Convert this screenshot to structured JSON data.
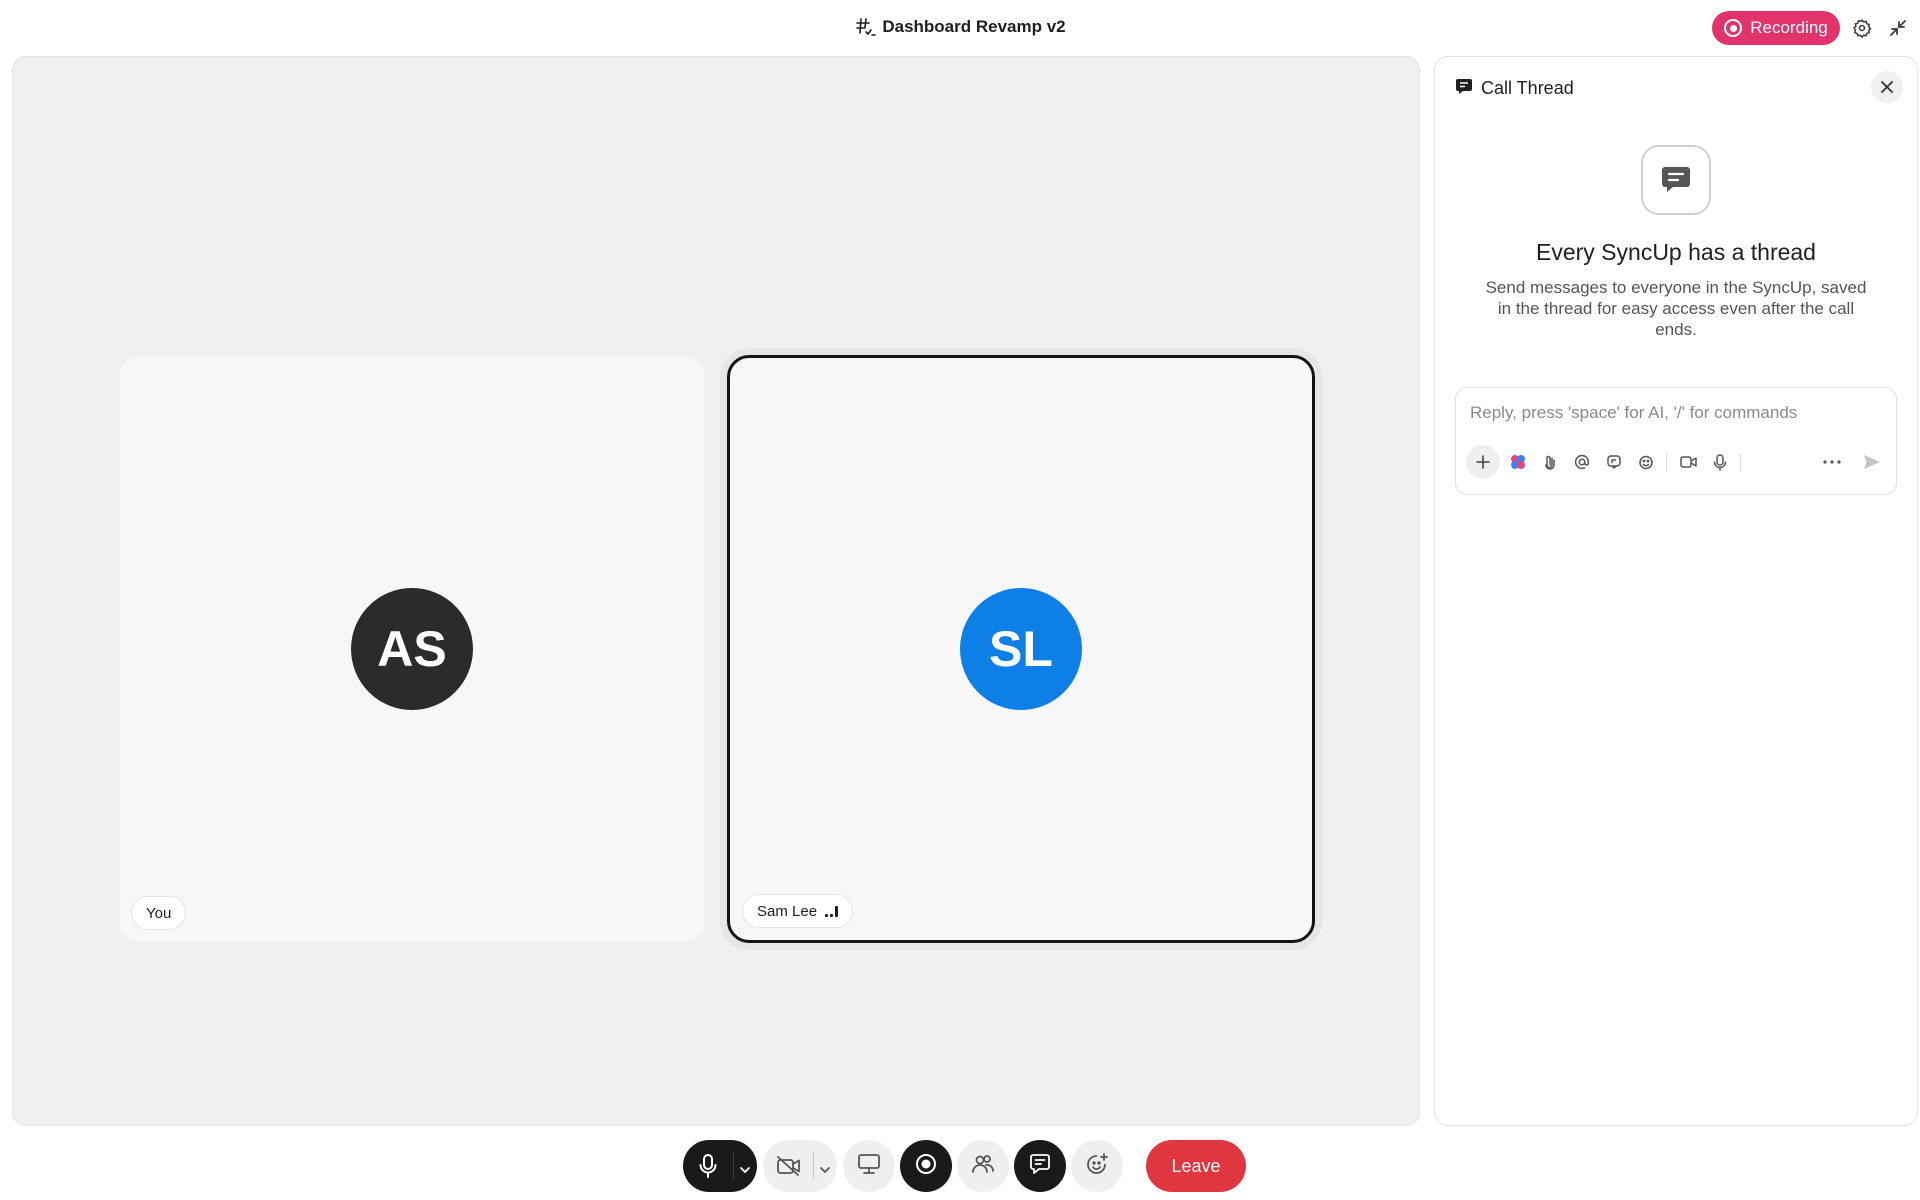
{
  "header": {
    "title": "Dashboard Revamp v2",
    "title_icon": "hash-checklist-icon",
    "recording_label": "Recording",
    "recording_color": "#e2336b"
  },
  "stage": {
    "participants": [
      {
        "initials": "AS",
        "label": "You",
        "avatar_color": "#2b2b2e",
        "active": false
      },
      {
        "initials": "SL",
        "label": "Sam Lee",
        "avatar_color": "#0f7fe8",
        "active": true
      }
    ]
  },
  "thread": {
    "title": "Call Thread",
    "empty_title": "Every SyncUp has a thread",
    "empty_desc": "Send messages to everyone in the SyncUp, saved in the thread for easy access even after the call ends.",
    "composer_placeholder": "Reply, press 'space' for AI, '/' for commands"
  },
  "controls": {
    "leave_label": "Leave",
    "leave_color": "#e0363f"
  }
}
